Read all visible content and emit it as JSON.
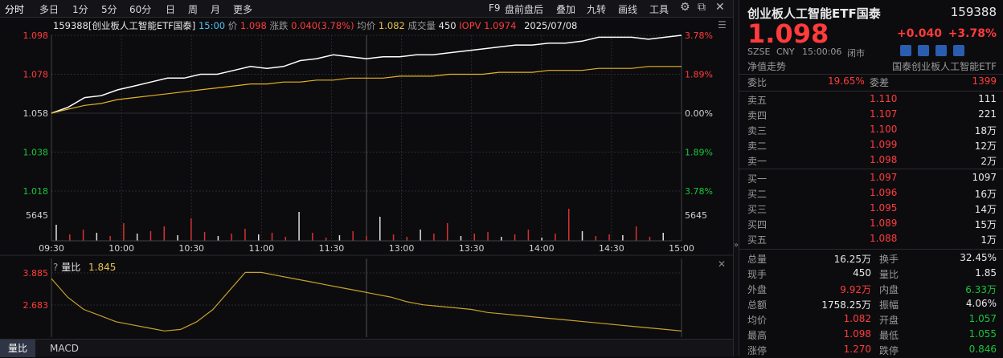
{
  "toolbar": {
    "periods": [
      "分时",
      "多日",
      "1分",
      "5分",
      "60分",
      "日",
      "周",
      "月",
      "更多"
    ],
    "tools": [
      "F9",
      "盘前盘后",
      "叠加",
      "九转",
      "画线",
      "工具"
    ]
  },
  "info_bar": {
    "code_name": "159388[创业板人工智能ETF国泰]",
    "time": "15:00",
    "price_label": "价",
    "price": "1.098",
    "change_label": "涨跌",
    "change": "0.040(3.78%)",
    "avg_label": "均价",
    "avg": "1.082",
    "vol_label": "成交量",
    "vol": "450",
    "iopv_label": "IOPV",
    "iopv": "1.0974",
    "date": "2025/07/08"
  },
  "chart_data": {
    "type": "line",
    "title": "",
    "x_ticks": [
      "09:30",
      "10:00",
      "10:30",
      "11:00",
      "11:30",
      "13:00",
      "13:30",
      "14:00",
      "14:30",
      "15:00"
    ],
    "y_left_ticks": [
      "1.098",
      "1.078",
      "1.058",
      "1.038",
      "1.018"
    ],
    "y_right_ticks": [
      "3.78%",
      "1.89%",
      "0.00%",
      "1.89%",
      "3.78%"
    ],
    "ylim": [
      1.018,
      1.098
    ],
    "prev_close": 1.058,
    "vol_label": "5645",
    "series": [
      {
        "values": [
          1.058,
          1.061,
          1.066,
          1.067,
          1.07,
          1.072,
          1.074,
          1.076,
          1.076,
          1.078,
          1.078,
          1.08,
          1.082,
          1.081,
          1.082,
          1.085,
          1.086,
          1.088,
          1.087,
          1.086,
          1.087,
          1.087,
          1.088,
          1.088,
          1.089,
          1.09,
          1.091,
          1.092,
          1.093,
          1.093,
          1.094,
          1.094,
          1.095,
          1.097,
          1.097,
          1.097,
          1.096,
          1.097,
          1.098
        ]
      },
      {
        "values": [
          1.058,
          1.06,
          1.062,
          1.063,
          1.065,
          1.066,
          1.067,
          1.068,
          1.069,
          1.07,
          1.071,
          1.072,
          1.073,
          1.073,
          1.074,
          1.074,
          1.075,
          1.075,
          1.076,
          1.076,
          1.076,
          1.077,
          1.077,
          1.077,
          1.078,
          1.078,
          1.078,
          1.079,
          1.079,
          1.079,
          1.08,
          1.08,
          1.08,
          1.081,
          1.081,
          1.081,
          1.082,
          1.082,
          1.082
        ]
      }
    ]
  },
  "sub_chart": {
    "label": "量比",
    "value": "1.845",
    "y_ticks": [
      "3.885",
      "2.683"
    ]
  },
  "bottom_tabs": [
    "量比",
    "MACD"
  ],
  "quote": {
    "name": "创业板人工智能ETF国泰",
    "code": "159388",
    "price": "1.098",
    "change": "+0.040",
    "pct": "+3.78%",
    "exchange": "SZSE",
    "currency": "CNY",
    "time": "15:00:06",
    "status": "闭市",
    "nav_label": "净值走势",
    "fund_name": "国泰创业板人工智能ETF",
    "weibi_label": "委比",
    "weibi": "19.65%",
    "weicha_label": "委差",
    "weicha": "1399",
    "asks": [
      {
        "l": "卖五",
        "p": "1.110",
        "v": "111"
      },
      {
        "l": "卖四",
        "p": "1.107",
        "v": "221"
      },
      {
        "l": "卖三",
        "p": "1.100",
        "v": "18万"
      },
      {
        "l": "卖二",
        "p": "1.099",
        "v": "12万"
      },
      {
        "l": "卖一",
        "p": "1.098",
        "v": "2万"
      }
    ],
    "bids": [
      {
        "l": "买一",
        "p": "1.097",
        "v": "1097"
      },
      {
        "l": "买二",
        "p": "1.096",
        "v": "16万"
      },
      {
        "l": "买三",
        "p": "1.095",
        "v": "14万"
      },
      {
        "l": "买四",
        "p": "1.089",
        "v": "15万"
      },
      {
        "l": "买五",
        "p": "1.088",
        "v": "1万"
      }
    ],
    "stats": [
      [
        "总量",
        "16.25万",
        "换手",
        "32.45%"
      ],
      [
        "现手",
        "450",
        "量比",
        "1.85"
      ],
      [
        "外盘",
        "9.92万",
        "内盘",
        "6.33万"
      ],
      [
        "总额",
        "1758.25万",
        "振幅",
        "4.06%"
      ],
      [
        "均价",
        "1.082",
        "开盘",
        "1.057"
      ],
      [
        "最高",
        "1.098",
        "最低",
        "1.055"
      ],
      [
        "涨停",
        "1.270",
        "跌停",
        "0.846"
      ]
    ]
  }
}
